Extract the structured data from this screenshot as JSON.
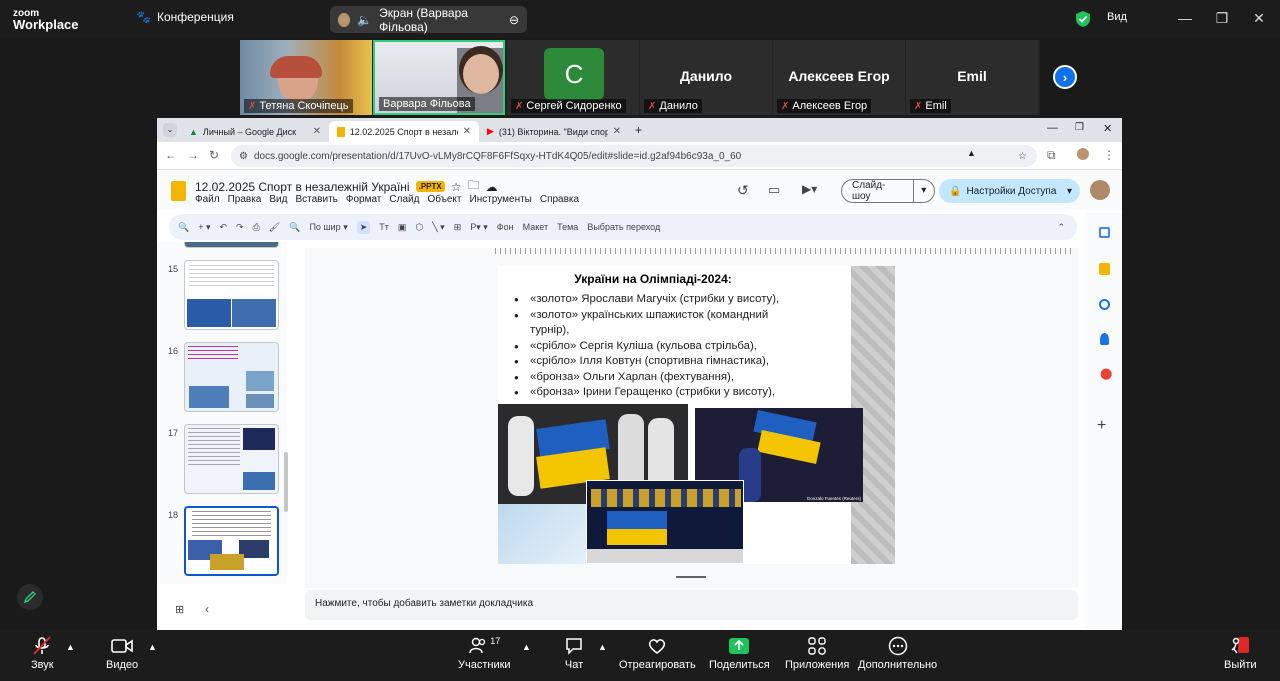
{
  "zoom": {
    "logo_line1": "zoom",
    "logo_line2": "Workplace",
    "conference_label": "Конференция",
    "share_label": "Экран (Варвара Фільова)",
    "view_label": "Вид",
    "participants": [
      {
        "name": "Тетяна Скочіпець",
        "video": true
      },
      {
        "name": "Варвара Фільова",
        "video": true,
        "active": true
      },
      {
        "name": "Сергей Сидоренко",
        "initial": "С"
      },
      {
        "name": "Данило",
        "big": "Данило"
      },
      {
        "name": "Алексеев Егор",
        "big": "Алексеев Егор"
      },
      {
        "name": "Emil",
        "big": "Emil"
      }
    ],
    "bottom": {
      "audio": "Звук",
      "video": "Видео",
      "participants": "Участники",
      "participants_count": "17",
      "chat": "Чат",
      "react": "Отреагировать",
      "share": "Поделиться",
      "apps": "Приложения",
      "more": "Дополнительно",
      "leave": "Выйти"
    },
    "colors": {
      "accent": "#0e72ed",
      "share_green": "#1fc35b",
      "leave_red": "#e02828"
    }
  },
  "browser": {
    "tabs": [
      {
        "label": "Личный – Google Диск"
      },
      {
        "label": "12.02.2025 Спорт в незалежн"
      },
      {
        "label": "(31) Вікторина. \"Види спорту\""
      }
    ],
    "url": "docs.google.com/presentation/d/17UvO-vLMy8rCQF8F6FfSqxy-HTdK4Q05/edit#slide=id.g2af94b6c93a_0_60"
  },
  "docs": {
    "title": "12.02.2025  Спорт в незалежній Україні",
    "badge": ".PPTX",
    "menus": [
      "Файл",
      "Правка",
      "Вид",
      "Вставить",
      "Формат",
      "Слайд",
      "Объект",
      "Инструменты",
      "Справка"
    ],
    "slideshow": "Слайд-шоу",
    "access": "Настройки Доступа",
    "toolbar": {
      "zoom": "По шир",
      "bg": "Фон",
      "layout": "Макет",
      "theme": "Тема",
      "transition": "Выбрать переход"
    },
    "thumbs": [
      "15",
      "16",
      "17",
      "18"
    ],
    "notes_placeholder": "Нажмите, чтобы добавить заметки докладчика",
    "slide": {
      "title": "України на Олімпіаді-2024:",
      "bullets": [
        "«золото» Ярослави Магучіх (стрибки у висоту),",
        "«золото» українських шпажисток (командний турнір),",
        "«срібло» Сергія Куліша (кульова стрільба),",
        "«срібло» Ілля Ковтун (спортивна гімнастика),",
        "«бронза» Ольги Харлан (фехтування),",
        "«бронза» Ірини Геращенко (стрибки у висоту),"
      ],
      "photo_credit": "Gonzalo Fuentes (Reuters)"
    }
  }
}
